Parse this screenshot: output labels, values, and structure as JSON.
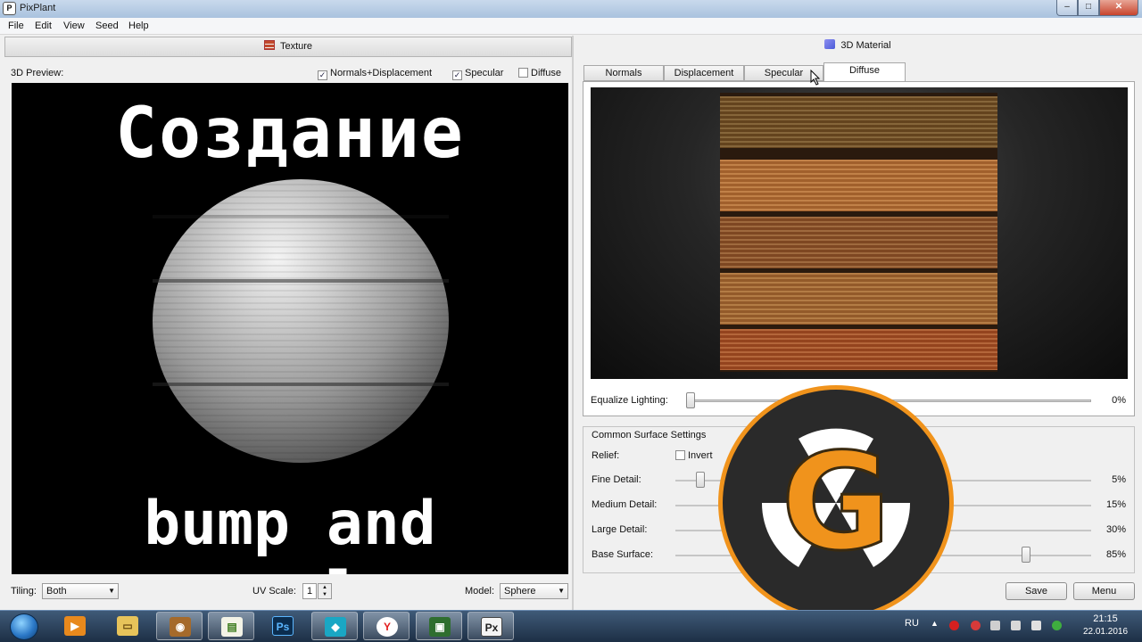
{
  "window": {
    "title": "PixPlant"
  },
  "menu": [
    "File",
    "Edit",
    "View",
    "Seed",
    "Help"
  ],
  "texture_panel": {
    "title": "Texture",
    "preview_label": "3D Preview:",
    "checkboxes": [
      {
        "label": "Normals+Displacement",
        "checked": true
      },
      {
        "label": "Specular",
        "checked": true
      },
      {
        "label": "Diffuse",
        "checked": false
      }
    ],
    "caption_top": "Создание",
    "caption_bottom": "bump and specular",
    "tiling_label": "Tiling:",
    "tiling_value": "Both",
    "uv_label": "UV Scale:",
    "uv_value": "1",
    "model_label": "Model:",
    "model_value": "Sphere"
  },
  "material_panel": {
    "title": "3D Material",
    "tabs": [
      "Normals",
      "Displacement",
      "Specular",
      "Diffuse"
    ],
    "active_tab": "Diffuse",
    "equalize_label": "Equalize Lighting:",
    "equalize_value": "0%",
    "equalize_level": 0,
    "settings_title": "Common Surface Settings",
    "relief_label": "Relief:",
    "invert_label": "Invert",
    "invert_checked": false,
    "sliders": [
      {
        "label": "Fine Detail:",
        "value": "5%",
        "level": 0.05
      },
      {
        "label": "Medium Detail:",
        "value": "15%",
        "level": 0.15
      },
      {
        "label": "Large Detail:",
        "value": "30%",
        "level": 0.3
      },
      {
        "label": "Base Surface:",
        "value": "85%",
        "level": 0.85
      }
    ],
    "save_label": "Save",
    "menu_label": "Menu"
  },
  "logo_letter": "G",
  "colors": {
    "logo_orange": "#f0931c",
    "logo_dark": "#2a2a2a",
    "title_bar": "#b9cde4",
    "taskbar": "#2a4360"
  },
  "taskbar": {
    "apps": [
      "media-player-icon",
      "file-explorer-icon",
      "gimp-icon",
      "spreadsheet-icon",
      "photoshop-icon",
      "app-icon",
      "yandex-browser-icon",
      "monitor-icon",
      "pixplant-icon"
    ],
    "photoshop_text": "Ps",
    "yandex_text": "Y",
    "pixplant_text": "Px",
    "language": "RU",
    "time": "21:15",
    "date": "22.01.2016"
  }
}
